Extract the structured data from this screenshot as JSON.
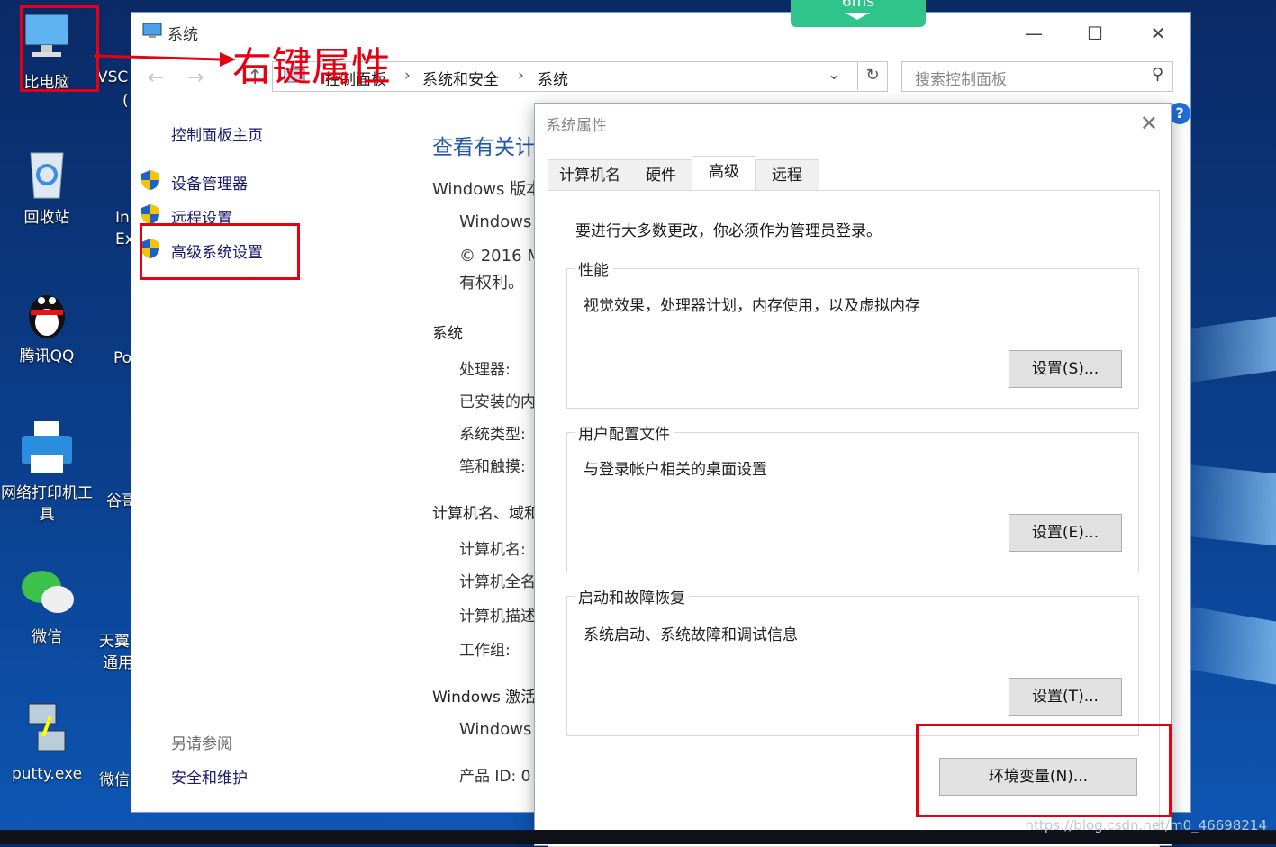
{
  "desktop": {
    "icons": [
      {
        "label": "比电脑"
      },
      {
        "label": "回收站"
      },
      {
        "label": "腾讯QQ"
      },
      {
        "label": "网络打印机工具"
      },
      {
        "label": "微信"
      },
      {
        "label": "putty.exe"
      }
    ],
    "col2": [
      "VSC",
      "(",
      "In",
      "Ex",
      "Po",
      "谷哥",
      "天翼",
      "通用",
      "微信"
    ]
  },
  "badge": {
    "text": "6ms"
  },
  "annotation": {
    "text": "右键属性"
  },
  "system_window": {
    "title": "系统",
    "breadcrumb": [
      "控制面板",
      "系统和安全",
      "系统"
    ],
    "breadcrumb_sep": "›",
    "search_placeholder": "搜索控制面板",
    "left_nav": {
      "home": "控制面板主页",
      "items": [
        "设备管理器",
        "远程设置",
        "高级系统设置"
      ],
      "see_also_title": "另请参阅",
      "see_also_items": [
        "安全和维护"
      ]
    },
    "main": {
      "heading": "查看有关计",
      "windows_edition_label": "Windows 版本",
      "windows_name": "Windows",
      "copyright1": "© 2016 M",
      "copyright2": "有权利。",
      "system_section": "系统",
      "processor": "处理器:",
      "installed_memory": "已安装的内",
      "system_type": "系统类型:",
      "pen_touch": "笔和触摸:",
      "computer_section": "计算机名、域和",
      "computer_name": "计算机名:",
      "full_computer_name": "计算机全名",
      "computer_desc": "计算机描述",
      "workgroup": "工作组:",
      "activation_section": "Windows 激活",
      "activation_windows": "Windows",
      "product_id": "产品 ID: 0"
    }
  },
  "dialog": {
    "title": "系统属性",
    "tabs": [
      "计算机名",
      "硬件",
      "高级",
      "远程"
    ],
    "active_tab": "高级",
    "admin_notice": "要进行大多数更改，你必须作为管理员登录。",
    "groups": [
      {
        "title": "性能",
        "desc": "视觉效果，处理器计划，内存使用，以及虚拟内存",
        "button": "设置(S)..."
      },
      {
        "title": "用户配置文件",
        "desc": "与登录帐户相关的桌面设置",
        "button": "设置(E)..."
      },
      {
        "title": "启动和故障恢复",
        "desc": "系统启动、系统故障和调试信息",
        "button": "设置(T)..."
      }
    ],
    "env_button": "环境变量(N)..."
  },
  "watermark": "https://blog.csdn.net/m0_46698214"
}
